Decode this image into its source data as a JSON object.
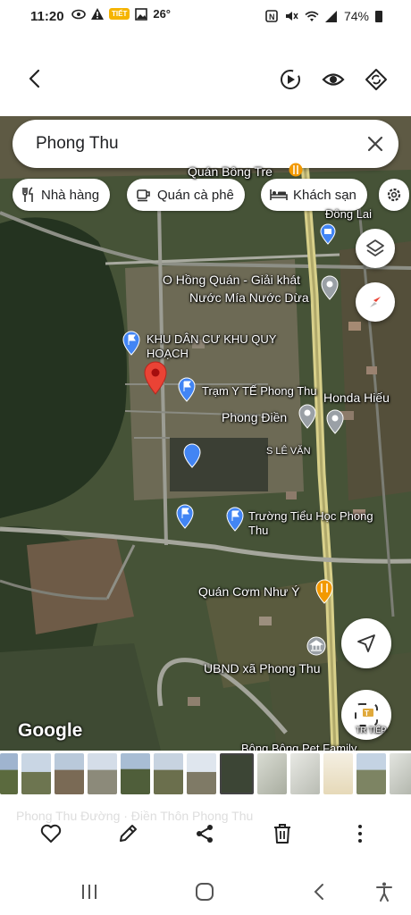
{
  "status_bar": {
    "time": "11:20",
    "temperature": "26°",
    "badge": "TIẾT",
    "battery": "74%"
  },
  "map": {
    "search_value": "Phong Thu",
    "chips": [
      "Nhà hàng",
      "Quán cà phê",
      "Khách sạn"
    ],
    "labels": {
      "quan_bong_tre": "Quán Bông Tre",
      "dong_lai": "Đông Lai",
      "hong_quan_1": "O Hồng Quán - Giải khát",
      "hong_quan_2": "Nước Mía Nước Dừa",
      "khu_dan_cu_1": "KHU DÂN CƯ KHU QUY",
      "khu_dan_cu_2": "HOẠCH",
      "tram_y_te": "Trạm Y TẾ Phong Thu",
      "honda": "Honda Hiếu",
      "phong_dien": "Phong Điền",
      "le_van": "S LÊ VĂN",
      "truong_1": "Trường Tiểu Học Phong",
      "truong_2": "Thu",
      "quan_com": "Quán Cơm Như Ý",
      "ubnd": "UBND xã Phong Thu",
      "bong_bong": "Bông Bông Pet Family",
      "trtiep": "TR TIẾP"
    },
    "attribution": "Google"
  },
  "caption_faint": "Phong Thu Đường · Điền Thôn Phong Thu",
  "colors": {
    "pin_red": "#ea4335",
    "pin_blue": "#4285f4",
    "poi_orange": "#f29900",
    "poi_gray": "#9aa0a6"
  }
}
